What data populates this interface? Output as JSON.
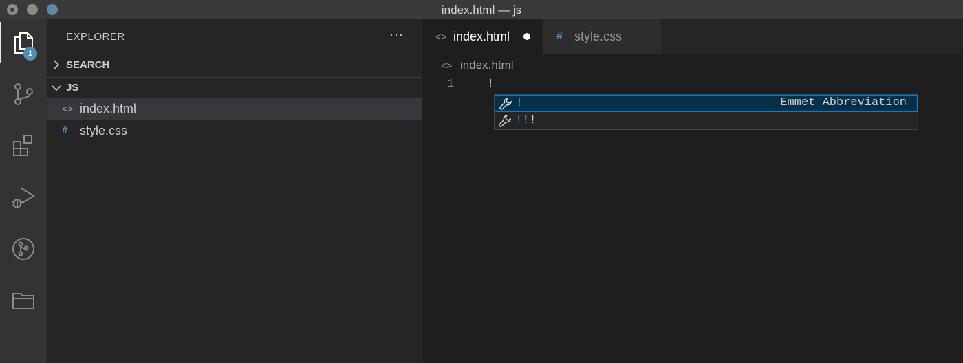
{
  "window": {
    "title": "index.html — js"
  },
  "activity_bar": {
    "items": [
      {
        "icon": "files-icon",
        "badge": "1"
      },
      {
        "icon": "source-control-icon"
      },
      {
        "icon": "extensions-icon"
      },
      {
        "icon": "run-debug-icon"
      },
      {
        "icon": "git-graph-icon"
      },
      {
        "icon": "folder-icon"
      }
    ]
  },
  "sidebar": {
    "header": "EXPLORER",
    "more": "···",
    "sections": [
      {
        "label": "SEARCH",
        "expanded": false
      },
      {
        "label": "JS",
        "expanded": true
      }
    ],
    "files": [
      {
        "name": "index.html",
        "icon": "<>",
        "selected": true
      },
      {
        "name": "style.css",
        "icon": "#",
        "selected": false
      }
    ]
  },
  "editor": {
    "tabs": [
      {
        "label": "index.html",
        "icon": "<>",
        "active": true,
        "modified": true
      },
      {
        "label": "style.css",
        "icon": "#",
        "active": false,
        "modified": false
      }
    ],
    "breadcrumb": {
      "icon": "<>",
      "label": "index.html"
    },
    "lines": [
      {
        "number": "1",
        "text": "!"
      }
    ],
    "suggestions": [
      {
        "match": "!",
        "rest": "",
        "detail": "Emmet Abbreviation",
        "selected": true
      },
      {
        "match": "!",
        "rest": "!!",
        "detail": "",
        "selected": false
      }
    ]
  },
  "colors": {
    "accent": "#007fd4",
    "badge": "#4f8fb3",
    "match_highlight": "#18a3ff",
    "css_icon": "#519aba"
  }
}
